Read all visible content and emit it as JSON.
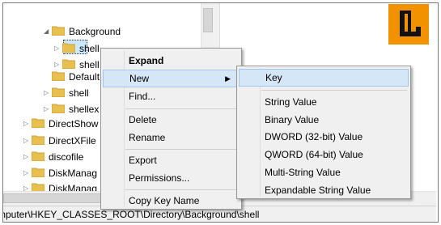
{
  "tree": {
    "items": [
      {
        "label": "Background",
        "indent": 2,
        "expanded": true
      },
      {
        "label": "shell",
        "indent": 3,
        "selected": true
      },
      {
        "label": "shell",
        "indent": 3
      },
      {
        "label": "DefaultI",
        "indent": 2
      },
      {
        "label": "shell",
        "indent": 2
      },
      {
        "label": "shellex",
        "indent": 2
      },
      {
        "label": "DirectShow",
        "indent": 1
      },
      {
        "label": "DirectXFile",
        "indent": 1
      },
      {
        "label": "discofile",
        "indent": 1
      },
      {
        "label": "DiskManag",
        "indent": 1
      },
      {
        "label": "DiskManag",
        "indent": 1
      }
    ]
  },
  "status": {
    "path": "mputer\\HKEY_CLASSES_ROOT\\Directory\\Background\\shell"
  },
  "context_menu": {
    "items": [
      "Expand",
      "New",
      "Find...",
      "Delete",
      "Rename",
      "Export",
      "Permissions...",
      "Copy Key Name"
    ]
  },
  "new_submenu": {
    "items": [
      "Key",
      "String Value",
      "Binary Value",
      "DWORD (32-bit) Value",
      "QWORD (64-bit) Value",
      "Multi-String Value",
      "Expandable String Value"
    ]
  },
  "colors": {
    "logo_bg": "#f39200",
    "highlight": "#d5e6f6",
    "folder": "#e8c050"
  }
}
